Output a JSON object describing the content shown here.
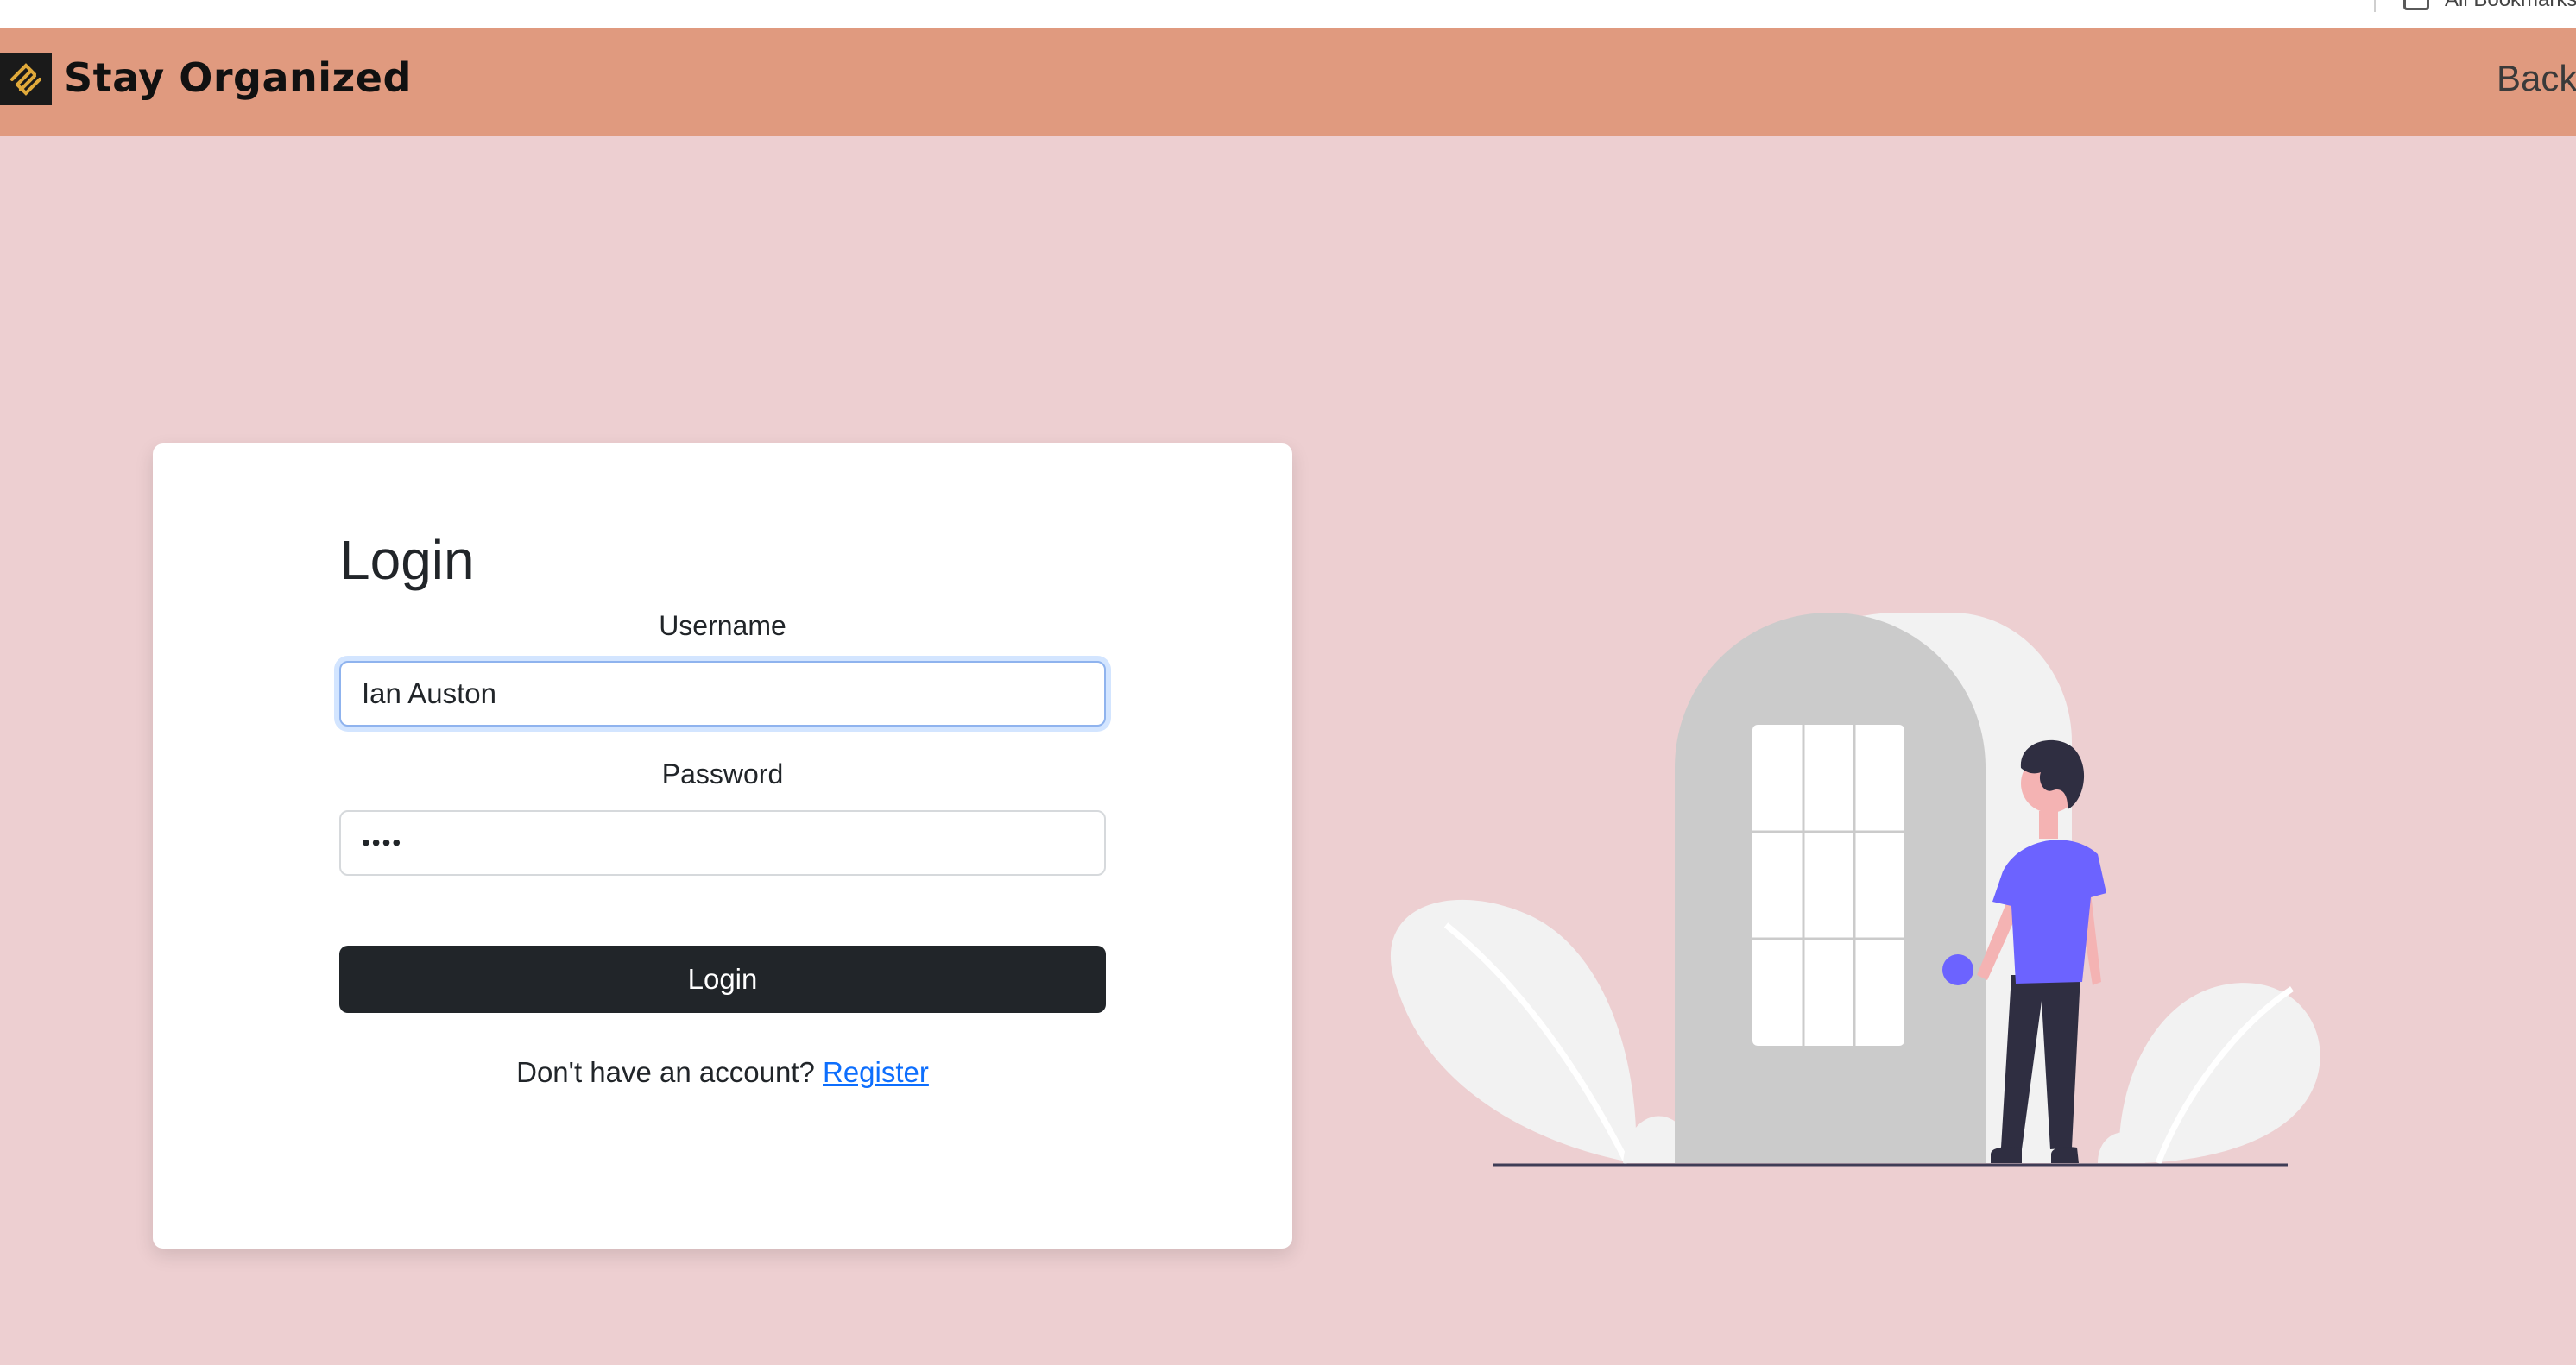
{
  "browser": {
    "bookmarks_label": "All Bookmarks"
  },
  "header": {
    "brand_title": "Stay Organized",
    "back_label": "Back",
    "logo_icon": "diagonal-stripes-logo-icon"
  },
  "login_form": {
    "title": "Login",
    "username": {
      "label": "Username",
      "value": "Ian Auston"
    },
    "password": {
      "label": "Password",
      "value": "••••"
    },
    "submit_label": "Login",
    "register_prompt": "Don't have an account?",
    "register_link": "Register"
  },
  "illustration": {
    "description_icon": "person-at-door-illustration"
  },
  "colors": {
    "page_background": "#edcfd1",
    "header_background": "#e09a7f",
    "button_background": "#212529",
    "link": "#0d6efd",
    "illustration_accent": "#6c63ff"
  }
}
